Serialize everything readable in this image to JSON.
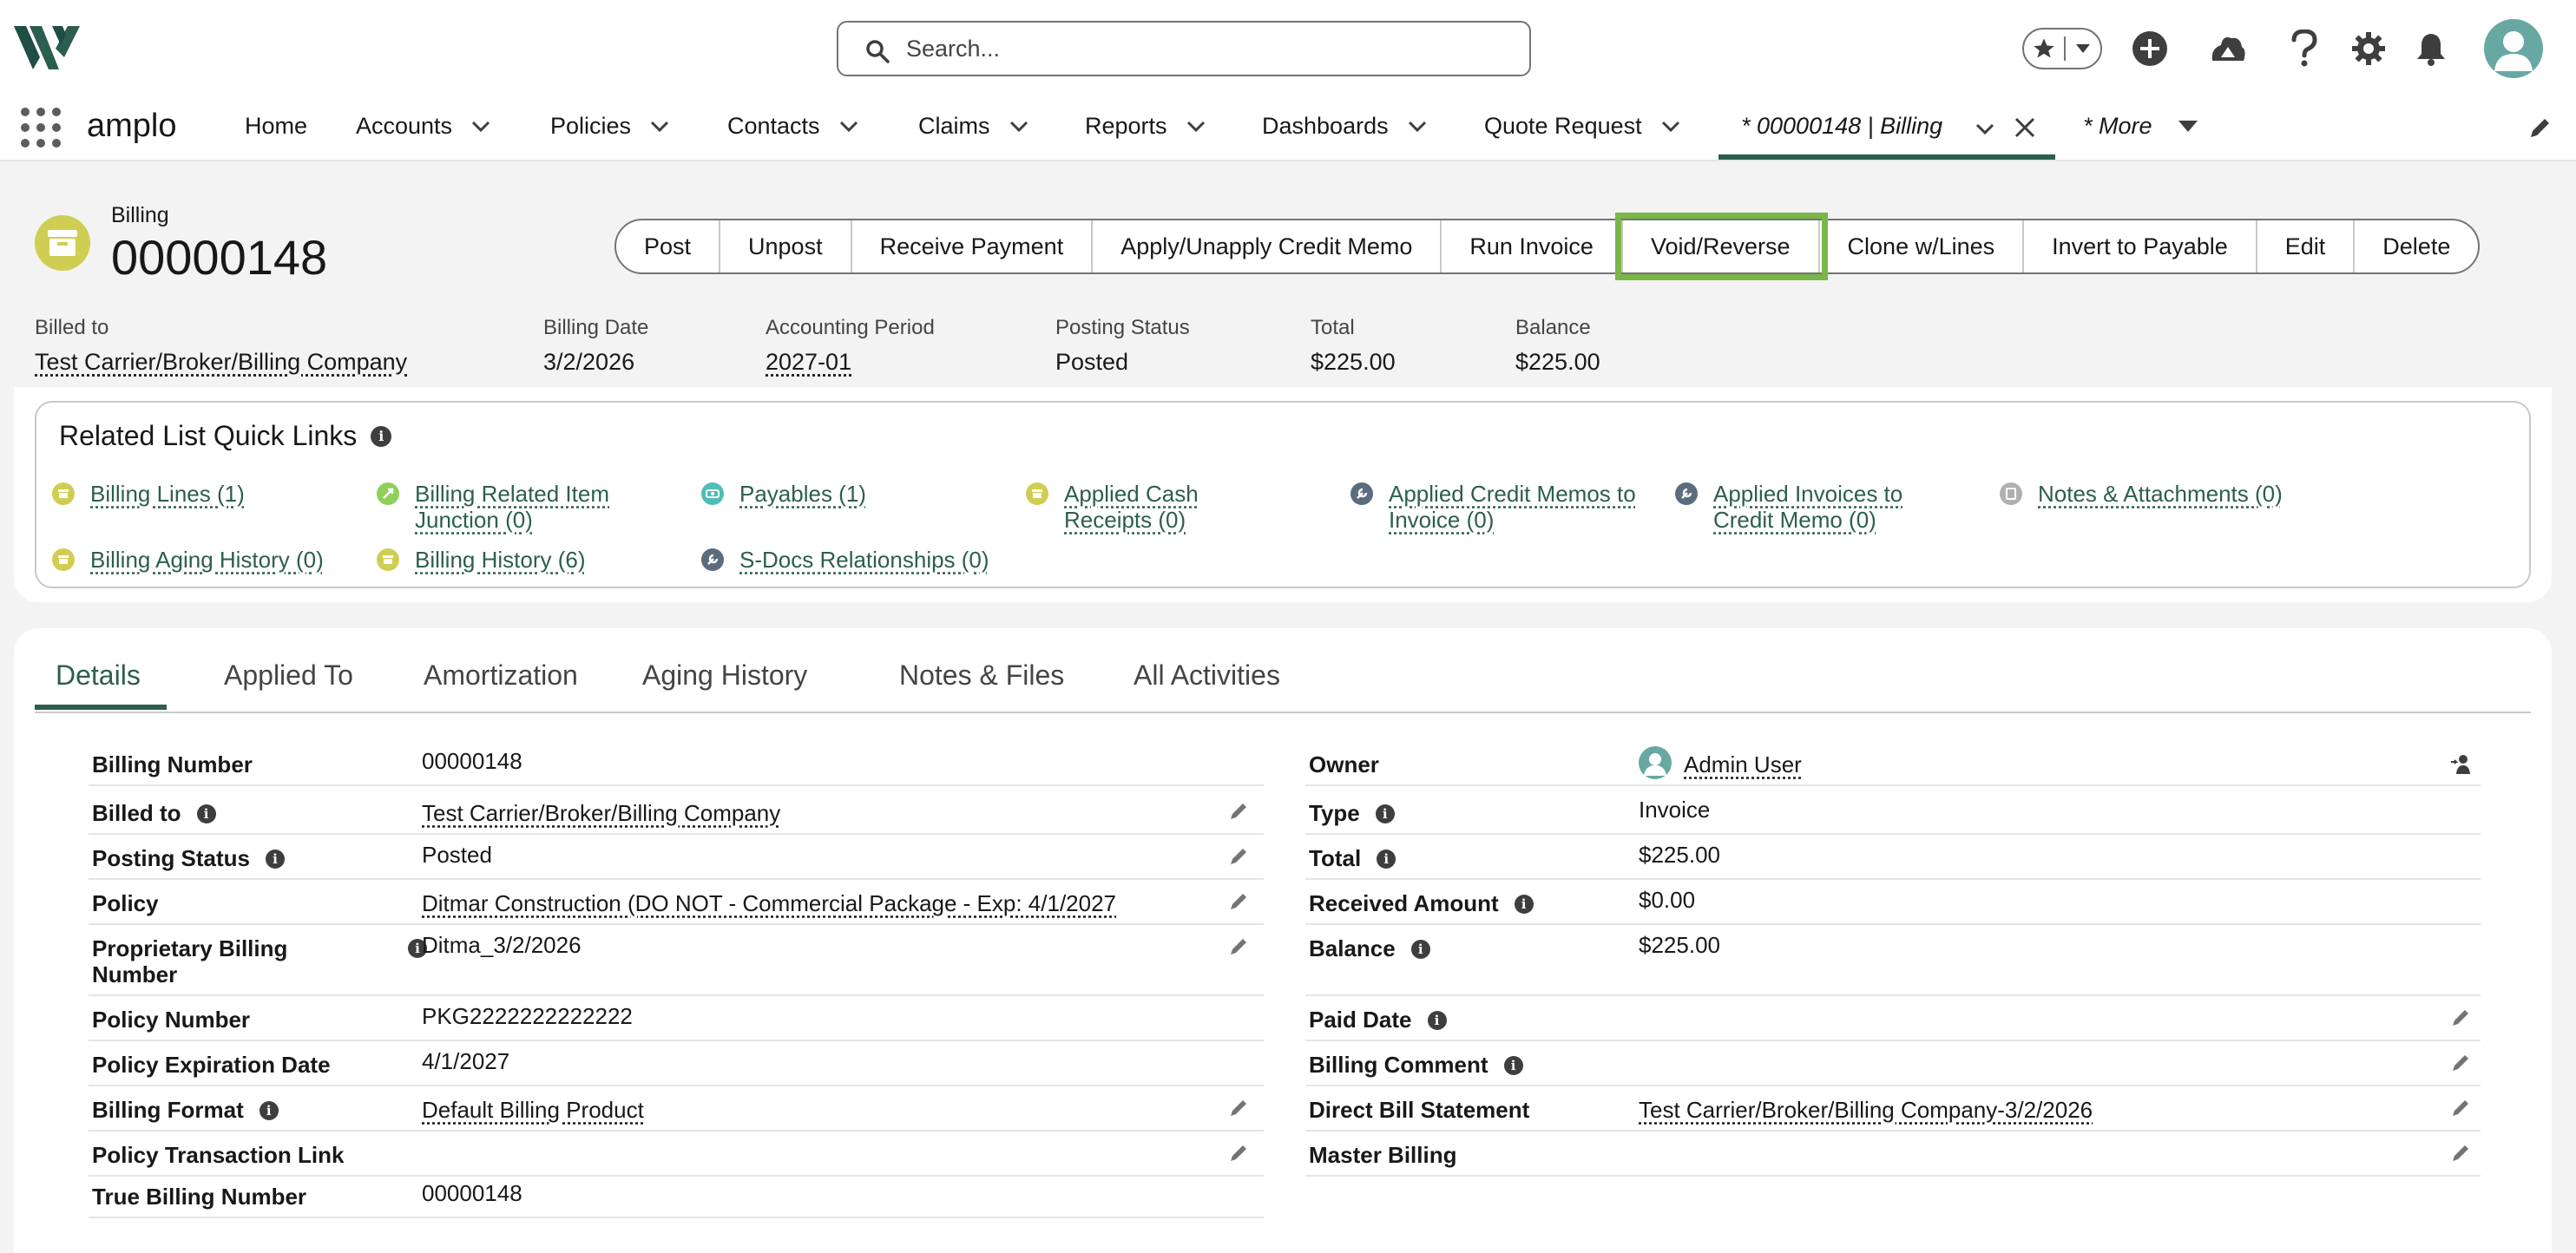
{
  "search": {
    "placeholder": "Search..."
  },
  "app": {
    "name": "amplo"
  },
  "nav": {
    "items": [
      {
        "label": "Home",
        "dropdown": false
      },
      {
        "label": "Accounts",
        "dropdown": true
      },
      {
        "label": "Policies",
        "dropdown": true
      },
      {
        "label": "Contacts",
        "dropdown": true
      },
      {
        "label": "Claims",
        "dropdown": true
      },
      {
        "label": "Reports",
        "dropdown": true
      },
      {
        "label": "Dashboards",
        "dropdown": true
      },
      {
        "label": "Quote Request",
        "dropdown": true
      }
    ],
    "active_tab": "* 00000148 | Billing",
    "more": "* More"
  },
  "record": {
    "type": "Billing",
    "name": "00000148",
    "actions": [
      "Post",
      "Unpost",
      "Receive Payment",
      "Apply/Unapply Credit Memo",
      "Run Invoice",
      "Void/Reverse",
      "Clone w/Lines",
      "Invert to Payable",
      "Edit",
      "Delete"
    ],
    "highlighted_action": "Void/Reverse",
    "highlights": [
      {
        "label": "Billed to",
        "value": "Test Carrier/Broker/Billing Company",
        "link": true
      },
      {
        "label": "Billing Date",
        "value": "3/2/2026",
        "link": false
      },
      {
        "label": "Accounting Period",
        "value": "2027-01",
        "link": true
      },
      {
        "label": "Posting Status",
        "value": "Posted",
        "link": false
      },
      {
        "label": "Total",
        "value": "$225.00",
        "link": false
      },
      {
        "label": "Balance",
        "value": "$225.00",
        "link": false
      }
    ]
  },
  "quick_links": {
    "title": "Related List Quick Links",
    "items": [
      {
        "line1": "Billing Lines (1)",
        "line2": "",
        "icon": "billing-icon",
        "color": "#cfce52"
      },
      {
        "line1": "Billing Related Item",
        "line2": "Junction (0)",
        "icon": "junction-icon",
        "color": "#8ed05a"
      },
      {
        "line1": "Payables (1)",
        "line2": "",
        "icon": "payables-icon",
        "color": "#4fbdb6"
      },
      {
        "line1": "Applied Cash",
        "line2": "Receipts (0)",
        "icon": "cash-receipt-icon",
        "color": "#cfce52"
      },
      {
        "line1": "Applied Credit Memos to",
        "line2": "Invoice (0)",
        "icon": "wrench-icon",
        "color": "#5a6c7d"
      },
      {
        "line1": "Applied Invoices to",
        "line2": "Credit Memo (0)",
        "icon": "wrench-icon",
        "color": "#5a6c7d"
      },
      {
        "line1": "Notes & Attachments (0)",
        "line2": "",
        "icon": "notes-icon",
        "color": "#b0b0b0"
      },
      {
        "line1": "Billing Aging History (0)",
        "line2": "",
        "icon": "billing-icon",
        "color": "#cfce52"
      },
      {
        "line1": "Billing History (6)",
        "line2": "",
        "icon": "billing-icon",
        "color": "#cfce52"
      },
      {
        "line1": "S-Docs Relationships (0)",
        "line2": "",
        "icon": "wrench-icon",
        "color": "#5a6c7d"
      }
    ]
  },
  "tabs": [
    "Details",
    "Applied To",
    "Amortization",
    "Aging History",
    "Notes & Files",
    "All Activities"
  ],
  "details_left": [
    {
      "label": "Billing Number",
      "value": "00000148",
      "info": false,
      "link": false,
      "editable": false
    },
    {
      "label": "Billed to",
      "value": "Test Carrier/Broker/Billing Company",
      "info": true,
      "link": true,
      "editable": true
    },
    {
      "label": "Posting Status",
      "value": "Posted",
      "info": true,
      "link": false,
      "editable": true
    },
    {
      "label": "Policy",
      "value": "Ditmar Construction (DO NOT - Commercial Package - Exp: 4/1/2027",
      "info": false,
      "link": true,
      "editable": true
    },
    {
      "label": "Proprietary Billing",
      "label2": "Number",
      "value": "Ditma_3/2/2026",
      "info": true,
      "link": false,
      "editable": true
    },
    {
      "label": "Policy Number",
      "value": "PKG2222222222222",
      "info": false,
      "link": false,
      "editable": false
    },
    {
      "label": "Policy Expiration Date",
      "value": "4/1/2027",
      "info": false,
      "link": false,
      "editable": false
    },
    {
      "label": "Billing Format",
      "value": "Default Billing Product",
      "info": true,
      "link": true,
      "editable": true
    },
    {
      "label": "Policy Transaction Link",
      "value": "",
      "info": false,
      "link": false,
      "editable": true
    },
    {
      "label": "True Billing Number",
      "value": "00000148",
      "info": false,
      "link": false,
      "editable": false
    }
  ],
  "details_right": [
    {
      "label": "Owner",
      "value": "Admin User",
      "info": false,
      "link": true,
      "editable": false
    },
    {
      "label": "Type",
      "value": "Invoice",
      "info": true,
      "link": false,
      "editable": false
    },
    {
      "label": "Total",
      "value": "$225.00",
      "info": true,
      "link": false,
      "editable": false
    },
    {
      "label": "Received Amount",
      "value": "$0.00",
      "info": true,
      "link": false,
      "editable": false
    },
    {
      "label": "Balance",
      "value": "$225.00",
      "info": true,
      "link": false,
      "editable": false
    },
    {
      "label": "Paid Date",
      "value": "",
      "info": true,
      "link": false,
      "editable": true
    },
    {
      "label": "Billing Comment",
      "value": "",
      "info": true,
      "link": false,
      "editable": true
    },
    {
      "label": "Direct Bill Statement",
      "value": "Test Carrier/Broker/Billing Company-3/2/2026",
      "info": false,
      "link": true,
      "editable": true
    },
    {
      "label": "Master Billing",
      "value": "",
      "info": false,
      "link": false,
      "editable": true
    }
  ],
  "colors": {
    "brand": "#2c5e50",
    "highlight": "#7ab648",
    "billing_icon": "#cfce52",
    "avatar": "#67a9a2"
  }
}
